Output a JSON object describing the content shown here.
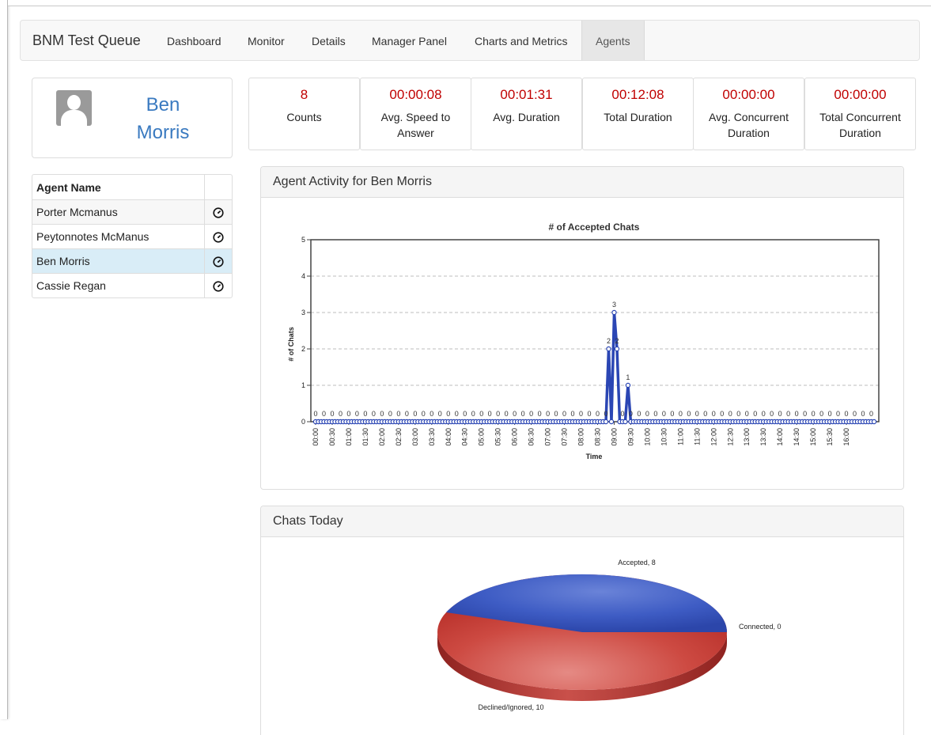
{
  "navbar": {
    "brand": "BNM Test Queue",
    "items": [
      {
        "label": "Dashboard"
      },
      {
        "label": "Monitor"
      },
      {
        "label": "Details"
      },
      {
        "label": "Manager Panel"
      },
      {
        "label": "Charts and Metrics"
      },
      {
        "label": "Agents",
        "active": true
      }
    ]
  },
  "profile": {
    "first_name": "Ben",
    "last_name": "Morris",
    "icon": "user-avatar-icon"
  },
  "stats": [
    {
      "value": "8",
      "label": "Counts"
    },
    {
      "value": "00:00:08",
      "label": "Avg. Speed to Answer"
    },
    {
      "value": "00:01:31",
      "label": "Avg. Duration"
    },
    {
      "value": "00:12:08",
      "label": "Total Duration"
    },
    {
      "value": "00:00:00",
      "label": "Avg. Concurrent Duration"
    },
    {
      "value": "00:00:00",
      "label": "Total Concurrent Duration"
    }
  ],
  "agent_table": {
    "header": "Agent Name",
    "rows": [
      {
        "name": "Porter Mcmanus",
        "icon": "timer-icon"
      },
      {
        "name": "Peytonnotes McManus",
        "icon": "timer-icon"
      },
      {
        "name": "Ben Morris",
        "icon": "timer-icon",
        "selected": true
      },
      {
        "name": "Cassie Regan",
        "icon": "timer-icon"
      }
    ]
  },
  "activity_panel": {
    "title": "Agent Activity for Ben Morris"
  },
  "chats_panel": {
    "title": "Chats Today"
  },
  "colors": {
    "accent_red": "#c00000",
    "link_blue": "#3a7ac0",
    "line_series": "#2b46b4",
    "pie_accepted": "#3553b8",
    "pie_declined": "#c43a33"
  },
  "chart_data": [
    {
      "type": "line",
      "title": "# of Accepted Chats",
      "xlabel": "Time",
      "ylabel": "# of Chats",
      "ylim": [
        0,
        5
      ],
      "yticks": [
        "0",
        "1",
        "2",
        "3",
        "4",
        "5"
      ],
      "grid": true,
      "x": [
        "00:00",
        "00:30",
        "01:00",
        "01:30",
        "02:00",
        "02:30",
        "03:00",
        "03:30",
        "04:00",
        "04:30",
        "05:00",
        "05:30",
        "06:00",
        "06:30",
        "07:00",
        "07:30",
        "08:00",
        "08:30",
        "09:00",
        "09:30",
        "10:00",
        "10:30",
        "11:00",
        "11:30",
        "12:00",
        "12:30",
        "13:00",
        "13:30",
        "14:00",
        "14:30",
        "15:00",
        "15:30",
        "16:00"
      ],
      "series": [
        {
          "values": [
            0,
            0,
            0,
            0,
            0,
            0,
            0,
            0,
            0,
            0,
            0,
            0,
            0,
            0,
            0,
            0,
            0,
            0,
            0,
            0,
            0,
            0,
            0,
            0,
            0,
            0,
            0,
            0,
            0,
            0,
            0,
            0,
            0,
            0,
            0,
            0,
            0,
            0,
            0,
            0,
            0,
            0,
            0,
            0,
            0,
            0,
            0,
            0,
            0,
            0,
            0,
            0,
            0,
            0,
            0,
            0,
            0,
            0,
            0,
            0,
            0,
            0,
            0,
            0,
            0,
            0,
            0,
            0,
            0,
            0,
            0,
            0,
            0,
            0,
            0,
            0,
            0,
            0,
            0,
            0,
            0,
            0,
            0,
            0,
            0,
            0,
            0,
            0,
            0,
            0,
            0,
            0,
            0,
            0,
            0,
            0,
            0,
            0,
            0,
            0,
            0,
            0,
            0,
            0,
            0,
            0,
            2,
            0,
            3,
            2,
            0,
            0,
            0,
            1,
            0,
            0,
            0,
            0,
            0,
            0,
            0,
            0,
            0,
            0,
            0,
            0,
            0,
            0,
            0,
            0,
            0,
            0,
            0,
            0,
            0,
            0,
            0,
            0,
            0,
            0,
            0,
            0,
            0,
            0,
            0,
            0,
            0,
            0,
            0,
            0,
            0,
            0,
            0,
            0,
            0,
            0,
            0,
            0,
            0,
            0,
            0,
            0,
            0,
            0,
            0,
            0,
            0,
            0,
            0,
            0,
            0,
            0,
            0,
            0,
            0,
            0,
            0,
            0,
            0,
            0,
            0,
            0,
            0,
            0,
            0,
            0,
            0,
            0,
            0,
            0,
            0,
            0,
            0,
            0,
            0,
            0,
            0,
            0,
            0,
            0,
            0,
            0,
            0
          ]
        }
      ],
      "point_interval_minutes": 15
    },
    {
      "type": "pie",
      "slices": [
        {
          "label": "Accepted",
          "value": 8
        },
        {
          "label": "Connected",
          "value": 0
        },
        {
          "label": "Declined/Ignored",
          "value": 10
        }
      ]
    }
  ]
}
